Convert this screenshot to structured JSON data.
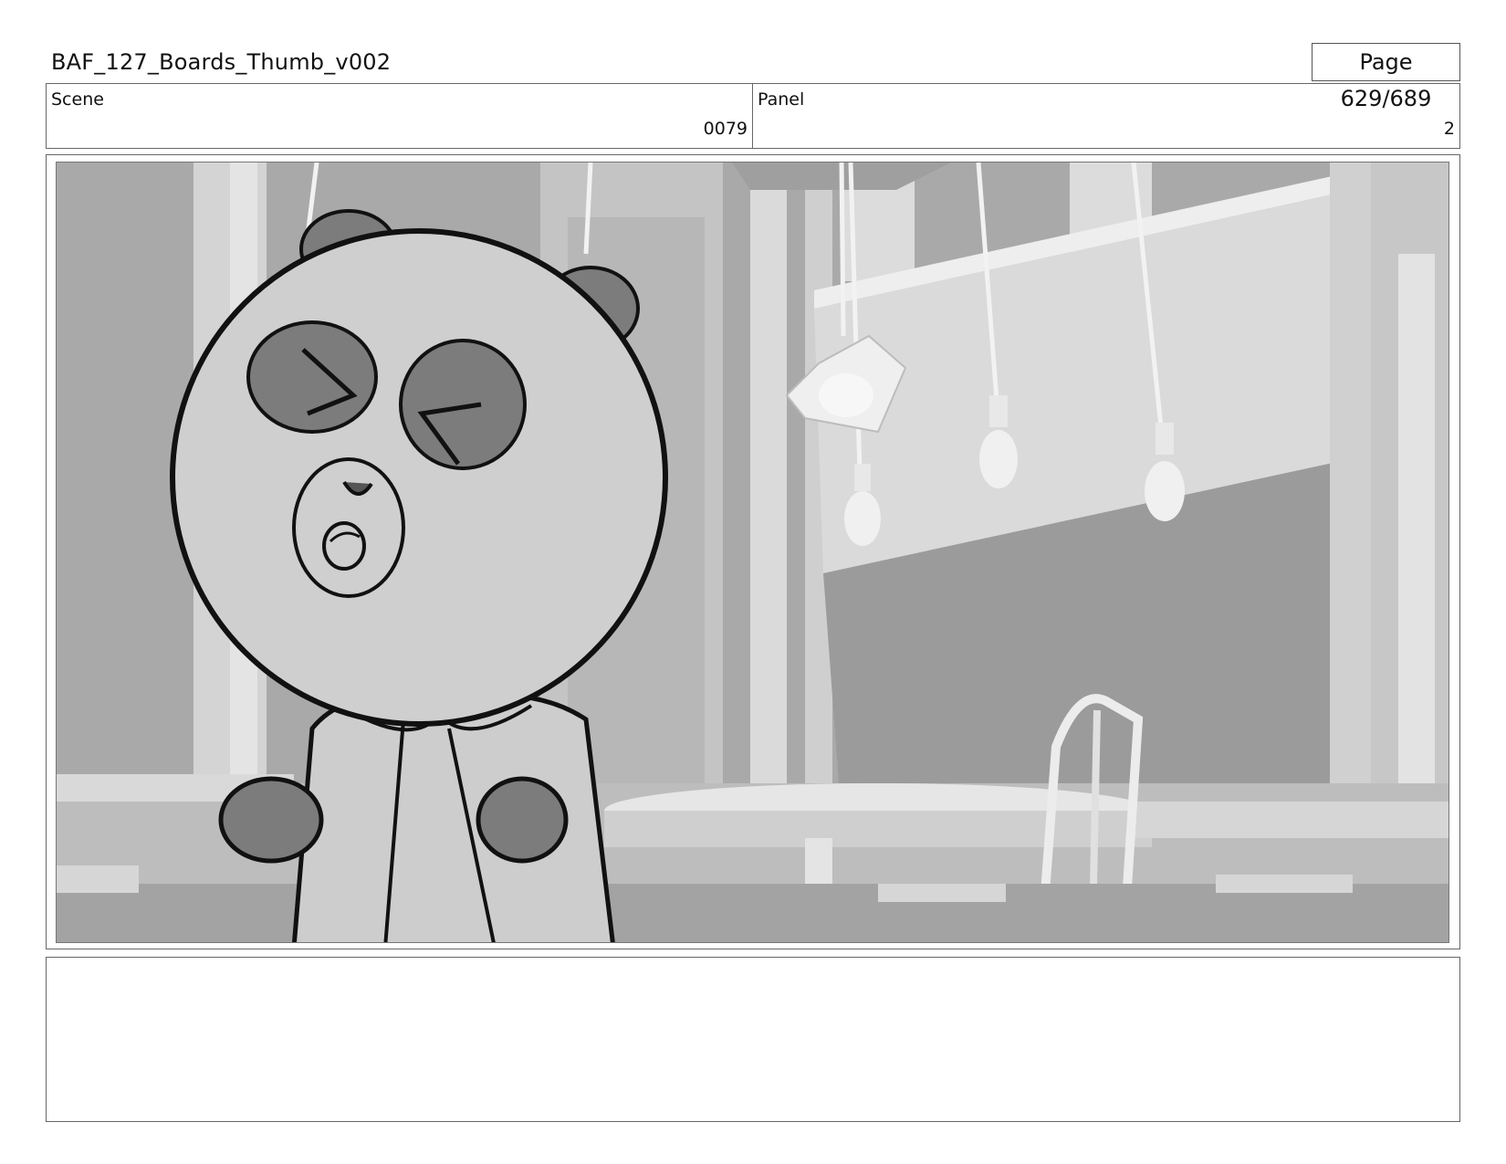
{
  "header": {
    "doc_title": "BAF_127_Boards_Thumb_v002",
    "page_indicator": "Page 629/689"
  },
  "info": {
    "scene_label": "Scene",
    "scene_value": "0079",
    "panel_label": "Panel",
    "panel_value": "2"
  },
  "panel_image": {
    "icon": "storyboard-sketch-panda-cafe",
    "palette": {
      "background": "#a8a8a8",
      "wall_light": "#d6d6d6",
      "wall_mid": "#bdbdbd",
      "window_dark": "#9c9c9c",
      "head_fill": "#cfcfcf",
      "patch_fill": "#7c7c7c",
      "ink": "#111111"
    }
  },
  "notes": {
    "text": ""
  }
}
